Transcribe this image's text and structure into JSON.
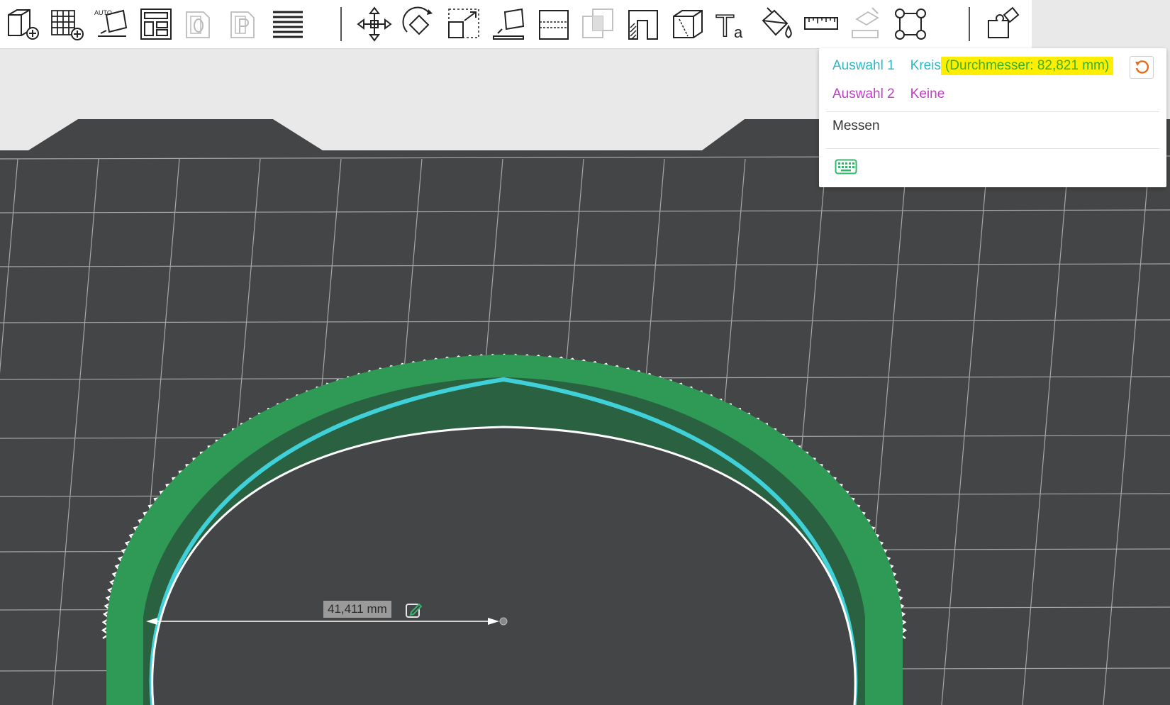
{
  "toolbar": {
    "buttons": [
      {
        "name": "add-object",
        "icon": "cube-add-icon",
        "enabled": true
      },
      {
        "name": "add-plate",
        "icon": "grid-add-icon",
        "enabled": true
      },
      {
        "name": "auto-orient",
        "icon": "auto-orient-icon",
        "label": "AUTO",
        "enabled": true
      },
      {
        "name": "arrange",
        "icon": "arrange-icon",
        "enabled": true
      },
      {
        "name": "split-objects",
        "icon": "split-objects-icon",
        "enabled": false
      },
      {
        "name": "split-parts",
        "icon": "split-parts-icon",
        "enabled": false
      },
      {
        "name": "variable-layer",
        "icon": "layers-icon",
        "enabled": true
      },
      {
        "name": "move",
        "icon": "move-icon",
        "enabled": true
      },
      {
        "name": "rotate",
        "icon": "rotate-icon",
        "enabled": true
      },
      {
        "name": "scale",
        "icon": "scale-icon",
        "enabled": true
      },
      {
        "name": "lay-on-face",
        "icon": "lay-on-face-icon",
        "enabled": true
      },
      {
        "name": "cut",
        "icon": "cut-icon",
        "enabled": true
      },
      {
        "name": "boolean",
        "icon": "boolean-icon",
        "enabled": false
      },
      {
        "name": "support-paint",
        "icon": "support-paint-icon",
        "enabled": true
      },
      {
        "name": "seam-paint",
        "icon": "seam-paint-icon",
        "enabled": true
      },
      {
        "name": "text",
        "icon": "text-icon",
        "label": "T",
        "sub": "a",
        "enabled": true
      },
      {
        "name": "color-paint",
        "icon": "paint-bucket-icon",
        "enabled": true
      },
      {
        "name": "measure",
        "icon": "ruler-icon",
        "enabled": true
      },
      {
        "name": "assembly",
        "icon": "assembly-icon",
        "enabled": false
      },
      {
        "name": "brim-ears",
        "icon": "brim-ears-icon",
        "enabled": true
      },
      {
        "name": "assembly-view",
        "icon": "puzzle-icon",
        "enabled": true
      }
    ]
  },
  "measure_panel": {
    "sel1_label": "Auswahl 1",
    "sel1_value": "Kreis",
    "sel1_extra": "(Durchmesser: 82,821 mm)",
    "sel2_label": "Auswahl 2",
    "sel2_value": "Keine",
    "title": "Messen",
    "reset_icon": "reset-icon",
    "keyboard_icon": "keyboard-icon"
  },
  "viewport": {
    "dimension_label": "41,411 mm",
    "edit_icon": "edit-icon"
  },
  "colors": {
    "model_green": "#2f9a55",
    "model_dark": "#2a6140",
    "selection_cyan": "#40d0d8",
    "plate_bg": "#444546",
    "highlight_yellow": "#ffee00",
    "reset_orange": "#e86a1a"
  }
}
